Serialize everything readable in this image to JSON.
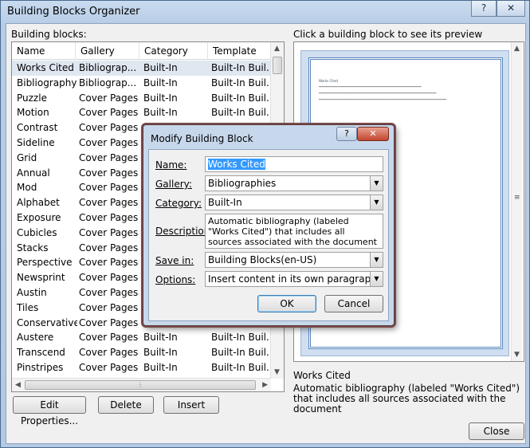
{
  "window": {
    "title": "Building Blocks Organizer",
    "help_glyph": "?",
    "close_glyph": "✕"
  },
  "organizer": {
    "list_label": "Building blocks:",
    "preview_label": "Click a building block to see its preview",
    "columns": [
      "Name",
      "Gallery",
      "Category",
      "Template"
    ],
    "rows": [
      {
        "name": "Works Cited",
        "gallery": "Bibliograp...",
        "category": "Built-In",
        "template": "Built-In Buil..."
      },
      {
        "name": "Bibliography",
        "gallery": "Bibliograp...",
        "category": "Built-In",
        "template": "Built-In Buil..."
      },
      {
        "name": "Puzzle",
        "gallery": "Cover Pages",
        "category": "Built-In",
        "template": "Built-In Buil..."
      },
      {
        "name": "Motion",
        "gallery": "Cover Pages",
        "category": "Built-In",
        "template": "Built-In Buil..."
      },
      {
        "name": "Contrast",
        "gallery": "Cover Pages",
        "category": "",
        "template": ""
      },
      {
        "name": "Sideline",
        "gallery": "Cover Pages",
        "category": "",
        "template": ""
      },
      {
        "name": "Grid",
        "gallery": "Cover Pages",
        "category": "",
        "template": ""
      },
      {
        "name": "Annual",
        "gallery": "Cover Pages",
        "category": "",
        "template": ""
      },
      {
        "name": "Mod",
        "gallery": "Cover Pages",
        "category": "",
        "template": ""
      },
      {
        "name": "Alphabet",
        "gallery": "Cover Pages",
        "category": "",
        "template": ""
      },
      {
        "name": "Exposure",
        "gallery": "Cover Pages",
        "category": "",
        "template": ""
      },
      {
        "name": "Cubicles",
        "gallery": "Cover Pages",
        "category": "",
        "template": ""
      },
      {
        "name": "Stacks",
        "gallery": "Cover Pages",
        "category": "",
        "template": ""
      },
      {
        "name": "Perspective",
        "gallery": "Cover Pages",
        "category": "",
        "template": ""
      },
      {
        "name": "Newsprint",
        "gallery": "Cover Pages",
        "category": "",
        "template": ""
      },
      {
        "name": "Austin",
        "gallery": "Cover Pages",
        "category": "",
        "template": ""
      },
      {
        "name": "Tiles",
        "gallery": "Cover Pages",
        "category": "",
        "template": ""
      },
      {
        "name": "Conservative",
        "gallery": "Cover Pages",
        "category": "",
        "template": ""
      },
      {
        "name": "Austere",
        "gallery": "Cover Pages",
        "category": "Built-In",
        "template": "Built-In Buil..."
      },
      {
        "name": "Transcend",
        "gallery": "Cover Pages",
        "category": "Built-In",
        "template": "Built-In Buil..."
      },
      {
        "name": "Pinstripes",
        "gallery": "Cover Pages",
        "category": "Built-In",
        "template": "Built-In Buil..."
      }
    ],
    "buttons": {
      "edit": "Edit Properties...",
      "delete": "Delete",
      "insert": "Insert",
      "close": "Close"
    },
    "selected_name": "Works Cited",
    "selected_description": "Automatic bibliography (labeled \"Works Cited\") that includes all sources associated with the document"
  },
  "modify_dialog": {
    "title": "Modify Building Block",
    "help_glyph": "?",
    "close_glyph": "✕",
    "labels": {
      "name": "Name:",
      "gallery": "Gallery:",
      "category": "Category:",
      "description": "Description:",
      "save_in": "Save in:",
      "options": "Options:"
    },
    "values": {
      "name": "Works Cited",
      "gallery": "Bibliographies",
      "category": "Built-In",
      "description": "Automatic bibliography (labeled \"Works Cited\") that includes all sources associated with the document",
      "save_in": "Building Blocks(en-US)",
      "options": "Insert content in its own paragraph"
    },
    "buttons": {
      "ok": "OK",
      "cancel": "Cancel"
    }
  },
  "colors": {
    "accent": "#3399ff",
    "dialog_close": "#c2452d"
  }
}
